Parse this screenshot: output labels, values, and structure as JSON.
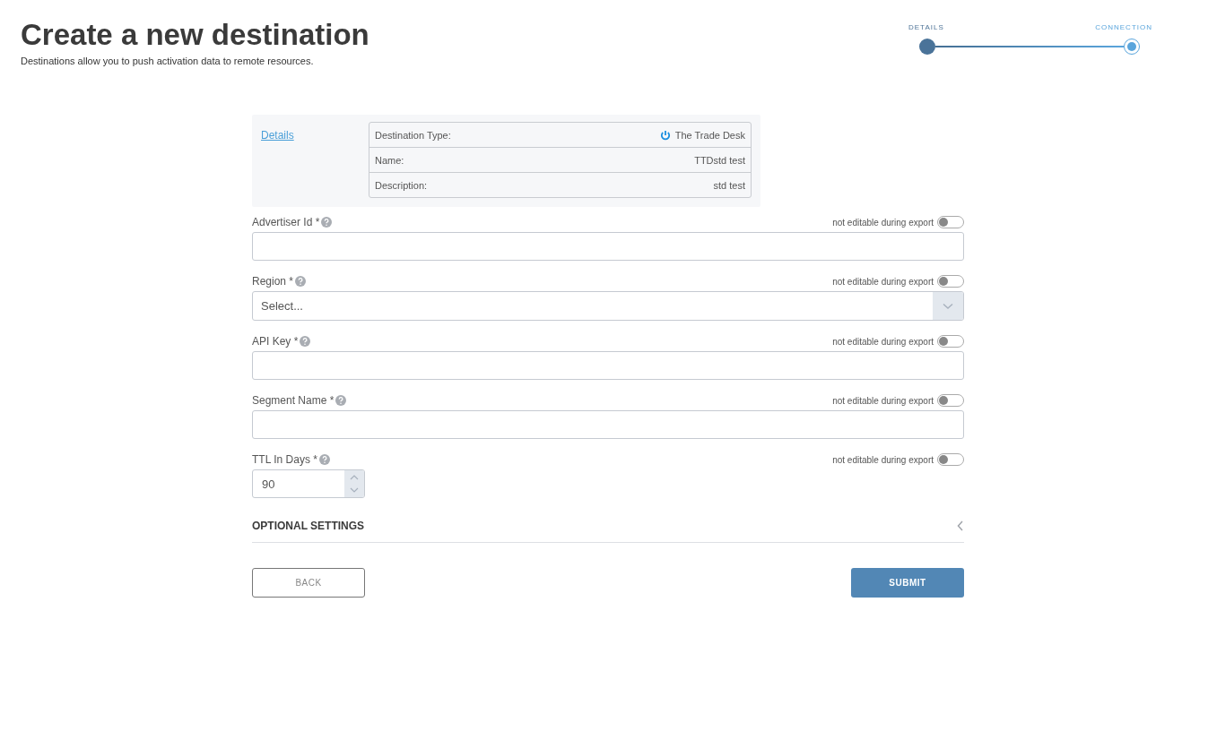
{
  "header": {
    "title": "Create a new destination",
    "subtitle": "Destinations allow you to push activation data to remote resources."
  },
  "steps": [
    {
      "label": "DETAILS",
      "selected": false
    },
    {
      "label": "CONNECTION",
      "selected": true
    }
  ],
  "summary": {
    "link": "Details",
    "rows": [
      {
        "label": "Destination Type:",
        "value": "The Trade Desk",
        "kind": "brand"
      },
      {
        "label": "Name:",
        "value": "TTDstd test",
        "kind": "plain"
      },
      {
        "label": "Description:",
        "value": "std test",
        "kind": "plain"
      }
    ]
  },
  "fields": [
    {
      "label": "Advertiser Id *",
      "kind": "text",
      "toggle_label": "not editable during export",
      "on": false
    },
    {
      "label": "Region *",
      "kind": "select",
      "placeholder": "Select...",
      "toggle_label": "not editable during export",
      "on": false
    },
    {
      "label": "API Key *",
      "kind": "text",
      "toggle_label": "not editable during export",
      "on": false
    },
    {
      "label": "Segment Name *",
      "kind": "text",
      "toggle_label": "not editable during export",
      "on": false
    },
    {
      "label": "TTL In Days *",
      "kind": "number",
      "value": "90",
      "toggle_label": "not editable during export",
      "on": false
    }
  ],
  "optional": {
    "title": "OPTIONAL SETTINGS",
    "expanded": false
  },
  "buttons": {
    "back": "BACK",
    "submit": "SUBMIT"
  }
}
